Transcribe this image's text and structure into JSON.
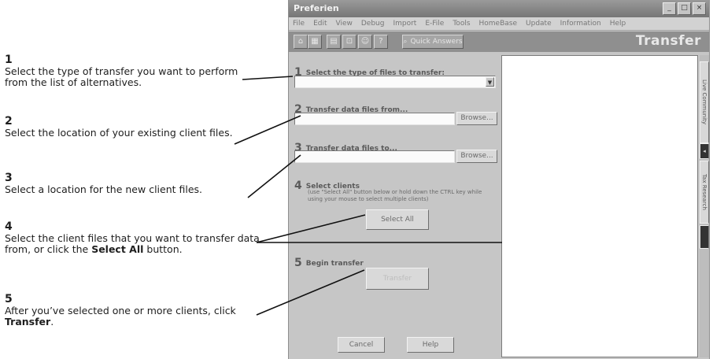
{
  "callouts": [
    {
      "num": "1",
      "text": "Select the type of transfer you want to perform from the list of alternatives."
    },
    {
      "num": "2",
      "text": "Select the location of your existing client files."
    },
    {
      "num": "3",
      "text": "Select a location for the new client files."
    },
    {
      "num": "4",
      "text_before": "Select the client files that you want to transfer data from, or click the ",
      "bold": "Select All",
      "text_after": " button."
    },
    {
      "num": "5",
      "text_before": "After you’ve selected one or more clients, click ",
      "bold": "Transfer",
      "text_after": "."
    }
  ],
  "window": {
    "title": "Preferien",
    "brand": "Transfer",
    "menu": [
      "File",
      "Edit",
      "View",
      "Debug",
      "Import",
      "E-File",
      "Tools",
      "HomeBase",
      "Update",
      "Information",
      "Help"
    ],
    "quick_answers": "Quick Answers"
  },
  "steps": {
    "s1": {
      "num": "1",
      "label": "Select the type of files to transfer:",
      "value": ""
    },
    "s2": {
      "num": "2",
      "label": "Transfer data files from...",
      "browse": "Browse..."
    },
    "s3": {
      "num": "3",
      "label": "Transfer data files to...",
      "browse": "Browse..."
    },
    "s4": {
      "num": "4",
      "label": "Select clients",
      "hint": "(use \"Select All\" button below or hold down the CTRL key while using your mouse to select multiple clients)",
      "button": "Select All"
    },
    "s5": {
      "num": "5",
      "label": "Begin transfer",
      "button": "Transfer"
    }
  },
  "footer": {
    "cancel": "Cancel",
    "help": "Help"
  },
  "side_tabs": [
    "Live Community",
    "Tax Research"
  ],
  "colors": {
    "window_bg": "#c6c6c6",
    "toolbar_bg": "#8f8f8f",
    "list_bg": "#ffffff",
    "leader_line": "#111111"
  }
}
